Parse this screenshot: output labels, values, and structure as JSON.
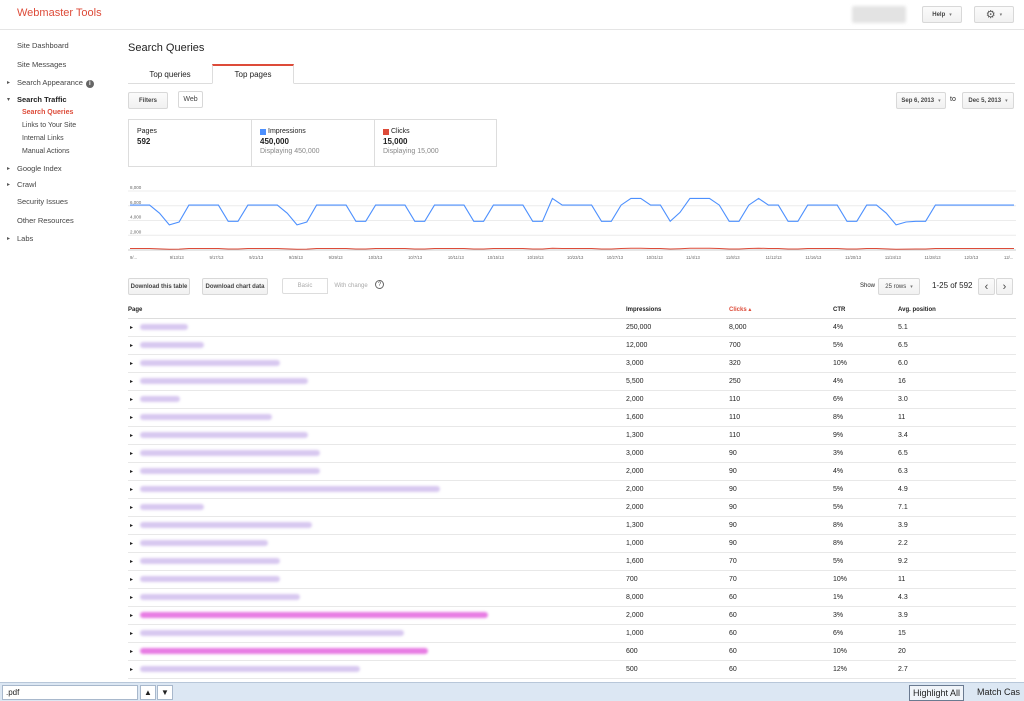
{
  "app": {
    "brand": "Webmaster Tools"
  },
  "header": {
    "help_label": "Help",
    "caret": "▾"
  },
  "sidebar": {
    "items": [
      {
        "label": "Site Dashboard"
      },
      {
        "label": "Site Messages"
      },
      {
        "label": "Search Appearance"
      },
      {
        "label": "Search Traffic"
      },
      {
        "label": "Search Queries"
      },
      {
        "label": "Links to Your Site"
      },
      {
        "label": "Internal Links"
      },
      {
        "label": "Manual Actions"
      },
      {
        "label": "Google Index"
      },
      {
        "label": "Crawl"
      },
      {
        "label": "Security Issues"
      },
      {
        "label": "Other Resources"
      },
      {
        "label": "Labs"
      }
    ]
  },
  "page": {
    "title": "Search Queries"
  },
  "tabs": [
    {
      "label": "Top queries"
    },
    {
      "label": "Top pages"
    }
  ],
  "filters": {
    "filters_label": "Filters",
    "web_label": "Web"
  },
  "dates": {
    "from": "Sep 6, 2013",
    "to_label": "to",
    "to": "Dec 5, 2013"
  },
  "summary": {
    "pages": {
      "label": "Pages",
      "value": "592"
    },
    "impressions": {
      "label": "Impressions",
      "value": "450,000",
      "sub": "Displaying 450,000",
      "color": "#4d90fe"
    },
    "clicks": {
      "label": "Clicks",
      "value": "15,000",
      "sub": "Displaying 15,000",
      "color": "#dd4b39"
    }
  },
  "chart_data": {
    "type": "line",
    "yticks": [
      "8,000",
      "6,000",
      "4,000",
      "2,000"
    ],
    "ylim": [
      0,
      9500
    ],
    "xticks": [
      "9/...",
      "9/13/13",
      "9/17/13",
      "9/21/13",
      "9/25/13",
      "9/29/13",
      "10/3/13",
      "10/7/13",
      "10/11/13",
      "10/15/13",
      "10/19/13",
      "10/23/13",
      "10/27/13",
      "10/31/13",
      "11/4/13",
      "11/8/13",
      "11/12/13",
      "11/16/13",
      "11/20/13",
      "11/24/13",
      "11/28/13",
      "12/2/13",
      "12/..."
    ],
    "series": [
      {
        "color": "#4d90fe",
        "values": [
          6100,
          6100,
          6100,
          5000,
          3400,
          3800,
          6100,
          6100,
          6100,
          6100,
          3900,
          3900,
          6100,
          6100,
          6100,
          6100,
          5000,
          3400,
          3800,
          6100,
          6100,
          6100,
          6100,
          3900,
          3900,
          6100,
          6100,
          6100,
          6100,
          3900,
          3900,
          6100,
          6100,
          6100,
          6100,
          3900,
          3900,
          6100,
          6100,
          6100,
          6100,
          3900,
          3900,
          7000,
          6100,
          6100,
          6100,
          6100,
          3900,
          3900,
          6100,
          7000,
          7000,
          6100,
          6100,
          3900,
          5100,
          7000,
          7000,
          7000,
          6100,
          3900,
          3900,
          6100,
          7000,
          6100,
          6100,
          3900,
          3900,
          6100,
          6100,
          6100,
          6100,
          3900,
          3900,
          6100,
          6100,
          5000,
          3400,
          3800,
          3900,
          3900,
          6100,
          6100,
          6100,
          6100,
          6100,
          6100,
          6100,
          6100,
          6100
        ]
      },
      {
        "color": "#dd4b39",
        "values": [
          200,
          200,
          200,
          150,
          100,
          120,
          200,
          200,
          200,
          200,
          130,
          130,
          200,
          200,
          200,
          200,
          150,
          100,
          120,
          200,
          200,
          200,
          200,
          130,
          130,
          200,
          200,
          200,
          200,
          130,
          130,
          200,
          200,
          200,
          200,
          130,
          130,
          200,
          200,
          200,
          200,
          130,
          130,
          240,
          200,
          200,
          200,
          200,
          130,
          130,
          200,
          240,
          240,
          200,
          200,
          130,
          170,
          240,
          240,
          240,
          200,
          130,
          130,
          200,
          240,
          200,
          200,
          130,
          130,
          200,
          200,
          200,
          200,
          130,
          130,
          200,
          200,
          150,
          100,
          120,
          130,
          130,
          200,
          200,
          200,
          200,
          200,
          200,
          200,
          200,
          200
        ]
      }
    ]
  },
  "table_toolbar": {
    "download_table": "Download this table",
    "download_chart": "Download chart data",
    "basic": "Basic",
    "with_change": "With change",
    "show_label": "Show",
    "rows_option": "25 rows",
    "range": "1-25 of 592",
    "prev": "‹",
    "next": "›"
  },
  "table": {
    "columns": [
      "Page",
      "Impressions",
      "Clicks ▴",
      "CTR",
      "Avg. position"
    ],
    "rows": [
      {
        "impr": "250,000",
        "clicks": "8,000",
        "ctr": "4%",
        "pos": "5.1"
      },
      {
        "impr": "12,000",
        "clicks": "700",
        "ctr": "5%",
        "pos": "6.5"
      },
      {
        "impr": "3,000",
        "clicks": "320",
        "ctr": "10%",
        "pos": "6.0"
      },
      {
        "impr": "5,500",
        "clicks": "250",
        "ctr": "4%",
        "pos": "16"
      },
      {
        "impr": "2,000",
        "clicks": "110",
        "ctr": "6%",
        "pos": "3.0"
      },
      {
        "impr": "1,600",
        "clicks": "110",
        "ctr": "8%",
        "pos": "11"
      },
      {
        "impr": "1,300",
        "clicks": "110",
        "ctr": "9%",
        "pos": "3.4"
      },
      {
        "impr": "3,000",
        "clicks": "90",
        "ctr": "3%",
        "pos": "6.5"
      },
      {
        "impr": "2,000",
        "clicks": "90",
        "ctr": "4%",
        "pos": "6.3"
      },
      {
        "impr": "2,000",
        "clicks": "90",
        "ctr": "5%",
        "pos": "4.9"
      },
      {
        "impr": "2,000",
        "clicks": "90",
        "ctr": "5%",
        "pos": "7.1"
      },
      {
        "impr": "1,300",
        "clicks": "90",
        "ctr": "8%",
        "pos": "3.9"
      },
      {
        "impr": "1,000",
        "clicks": "90",
        "ctr": "8%",
        "pos": "2.2"
      },
      {
        "impr": "1,600",
        "clicks": "70",
        "ctr": "5%",
        "pos": "9.2"
      },
      {
        "impr": "700",
        "clicks": "70",
        "ctr": "10%",
        "pos": "11"
      },
      {
        "impr": "8,000",
        "clicks": "60",
        "ctr": "1%",
        "pos": "4.3"
      },
      {
        "impr": "2,000",
        "clicks": "60",
        "ctr": "3%",
        "pos": "3.9"
      },
      {
        "impr": "1,000",
        "clicks": "60",
        "ctr": "6%",
        "pos": "15"
      },
      {
        "impr": "600",
        "clicks": "60",
        "ctr": "10%",
        "pos": "20"
      },
      {
        "impr": "500",
        "clicks": "60",
        "ctr": "12%",
        "pos": "2.7"
      }
    ]
  },
  "findbar": {
    "value": ".pdf",
    "up": "▲",
    "down": "▼",
    "highlight_all": "Highlight All",
    "match_case": "Match Cas"
  }
}
